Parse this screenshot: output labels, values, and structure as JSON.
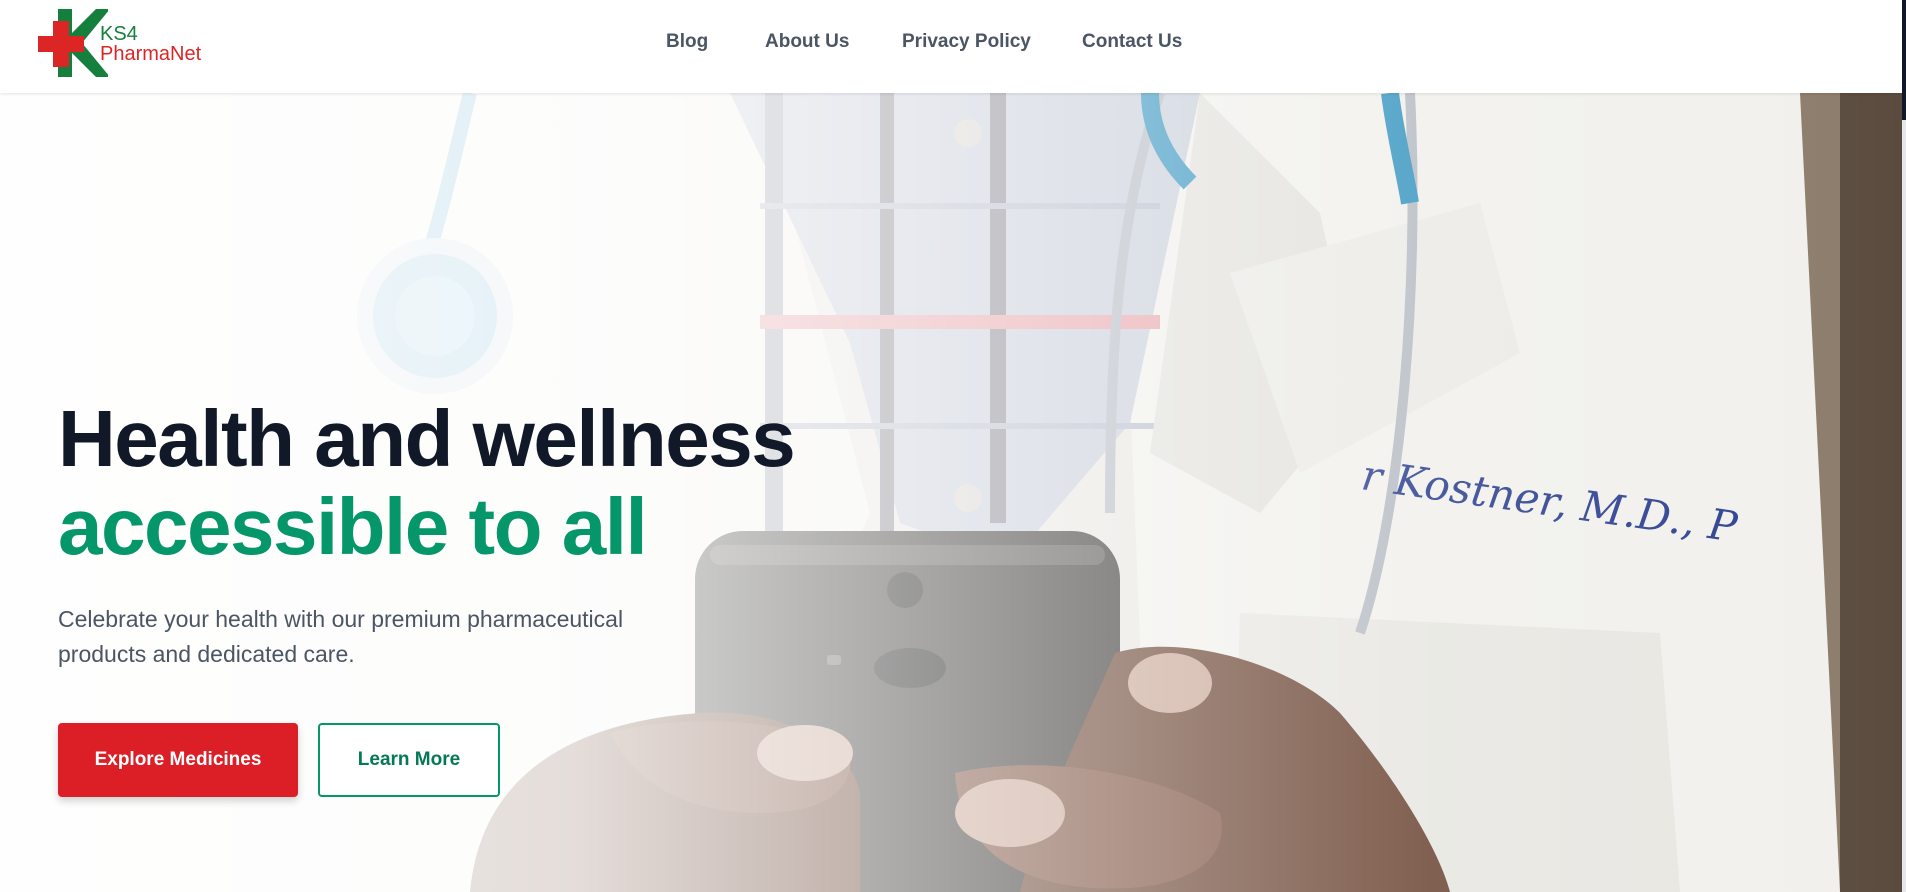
{
  "brand": {
    "line1": "KS4",
    "line2": "PharmaNet",
    "green": "#15803d",
    "red": "#dc2626"
  },
  "nav": {
    "items": [
      "Blog",
      "About Us",
      "Privacy Policy",
      "Contact Us"
    ]
  },
  "hero": {
    "title_line1": "Health and wellness",
    "title_line2": "accessible to all",
    "subtitle": "Celebrate your health with our premium pharmaceutical products and dedicated care.",
    "primary_button": "Explore Medicines",
    "secondary_button": "Learn More",
    "background": "doctor-holding-phone-photo"
  },
  "colors": {
    "accent_green": "#059669",
    "accent_red": "#dc1f26",
    "heading_dark": "#111827",
    "body_text": "#4b5563"
  }
}
